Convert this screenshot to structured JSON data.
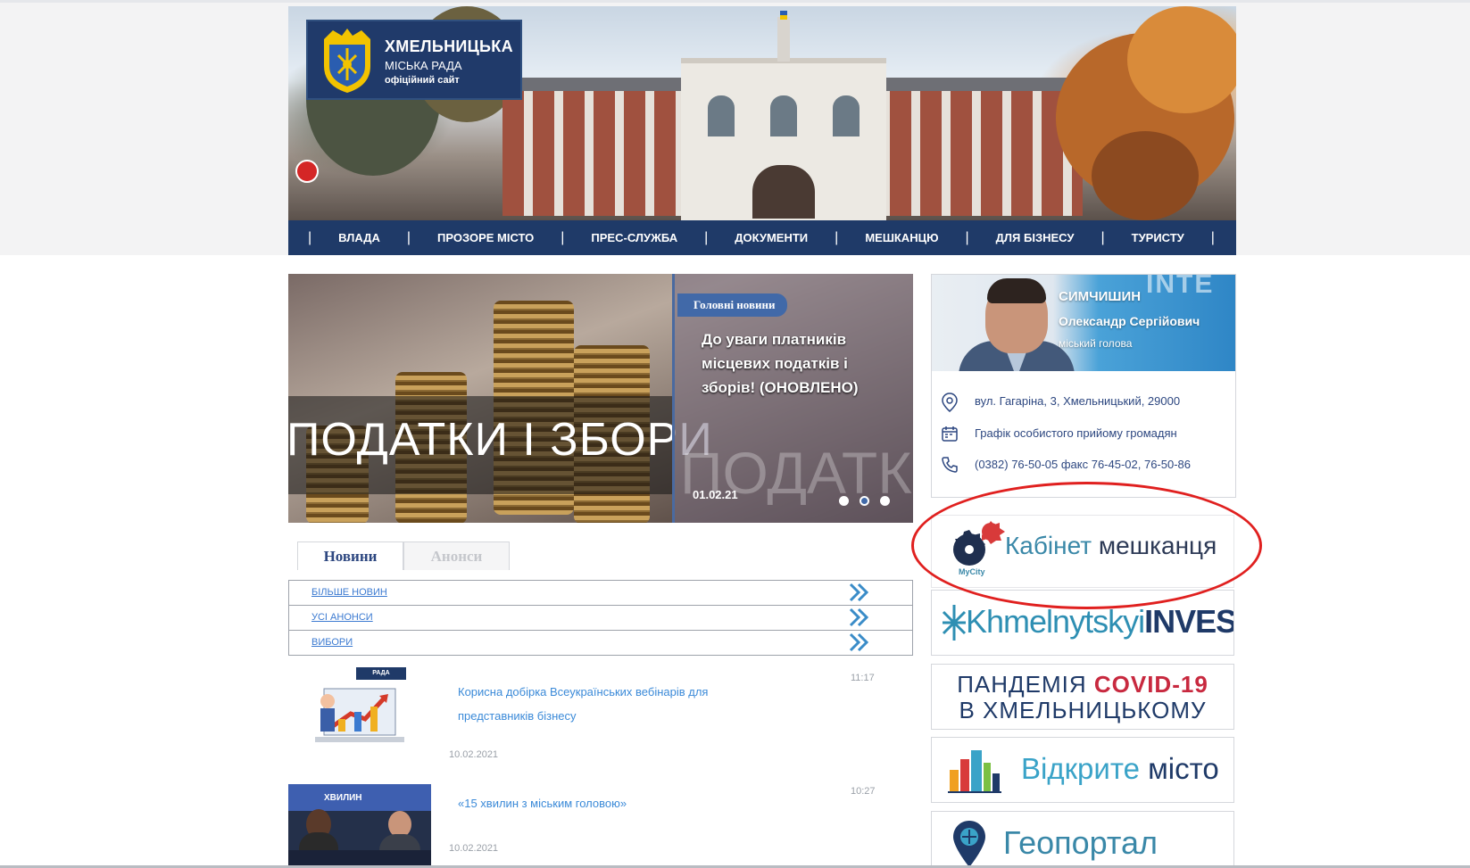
{
  "header": {
    "logo": {
      "line1": "ХМЕЛЬНИЦЬКА",
      "line2": "МІСЬКА РАДА",
      "line3": "офіційний сайт"
    },
    "nav": [
      {
        "label": "ВЛАДА"
      },
      {
        "label": "ПРОЗОРЕ МІСТО"
      },
      {
        "label": "ПРЕС-СЛУЖБА"
      },
      {
        "label": "ДОКУМЕНТИ"
      },
      {
        "label": "МЕШКАНЦЮ"
      },
      {
        "label": "ДЛЯ БІЗНЕСУ"
      },
      {
        "label": "ТУРИСТУ"
      }
    ]
  },
  "slider": {
    "image_text": "ПОДАТКИ І ЗБОРИ",
    "panel_bg_text": "ПОДАТК",
    "tag": "Головні новини",
    "title": "До уваги платників місцевих податків і зборів! (ОНОВЛЕНО)",
    "date": "01.02.21",
    "dots": [
      {
        "active": false
      },
      {
        "active": true
      },
      {
        "active": false
      }
    ]
  },
  "tabs": [
    {
      "label": "Новини",
      "active": true
    },
    {
      "label": "Анонси",
      "active": false
    }
  ],
  "links": [
    {
      "label": "БІЛЬШЕ НОВИН"
    },
    {
      "label": "УСІ АНОНСИ"
    },
    {
      "label": "ВИБОРИ"
    }
  ],
  "news": [
    {
      "title": "Корисна добірка Всеукраїнських вебінарів для представників бізнесу",
      "time": "11:17",
      "date": "10.02.2021",
      "thumb_label": "РАДА"
    },
    {
      "title": "«15 хвилин з міським головою»",
      "time": "10:27",
      "date": "10.02.2021",
      "thumb_label": "ХВИЛИН"
    }
  ],
  "mayor": {
    "surname": "СИМЧИШИН",
    "name": "Олександр Сергійович",
    "role": "міський голова",
    "bg_text": "INTE",
    "address": "вул. Гагаріна, 3, Хмельницький, 29000",
    "schedule": "Графік особистого прийому громадян",
    "phones": "(0382) 76-50-05 факс 76-45-02, 76-50-86"
  },
  "banners": {
    "cabinet": {
      "word1": "Кабінет",
      "word2": "мешканця",
      "brand": "MyCity"
    },
    "invest": {
      "part1": "Khmelnytskyi",
      "part2": "INVEST"
    },
    "covid": {
      "line1a": "ПАНДЕМІЯ",
      "line1b": "COVID-19",
      "line2": "В ХМЕЛЬНИЦЬКОМУ"
    },
    "open_city": {
      "word1": "Відкрите",
      "word2": "місто"
    },
    "geoportal": {
      "label": "Геопортал"
    }
  },
  "colors": {
    "nav_bg": "#1f3a68",
    "accent": "#4169a8",
    "link": "#3b7ad1",
    "annotation": "#e0201f",
    "covid_red": "#c8293f"
  }
}
